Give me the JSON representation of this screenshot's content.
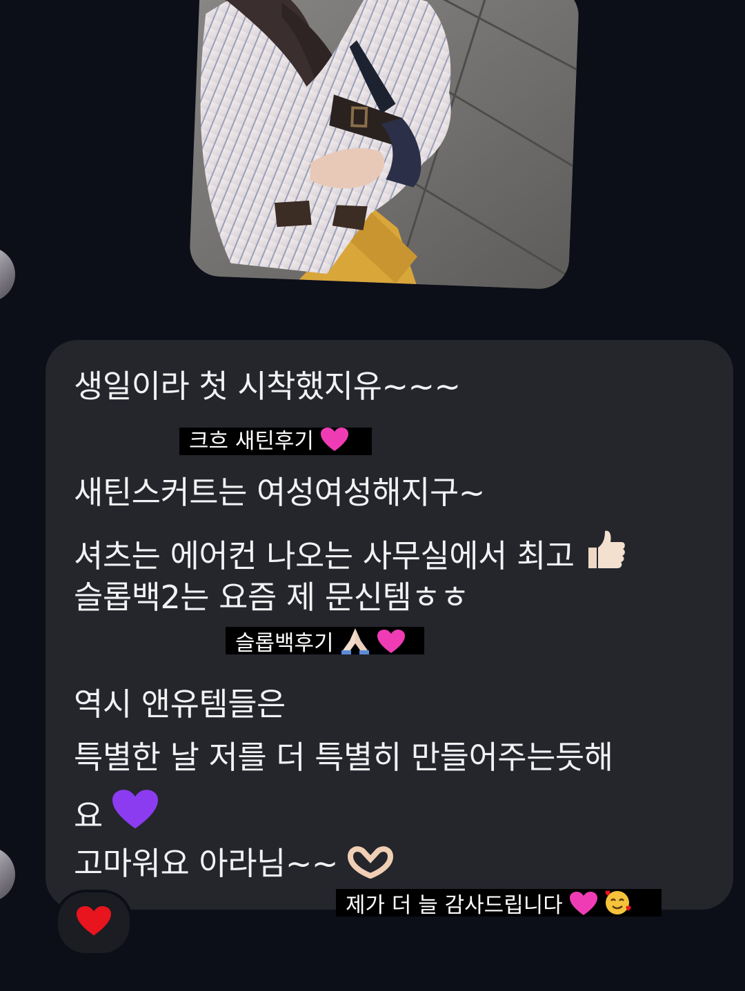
{
  "photo": {
    "icon": "photo-message"
  },
  "message": {
    "line1": "생일이라 첫 시착했지유~~~",
    "line2": "새틴스커트는 여성여성해지구~",
    "line3": "셔츠는 에어컨 나오는 사무실에서 최고",
    "line4": "슬롭백2는 요즘 제 문신템ㅎㅎ",
    "line5": "역시 앤유템들은",
    "line6": "특별한 날 저를 더 특별히 만들어주는듯해",
    "line7": "요",
    "line8": "고마워요 아라님~~"
  },
  "captions": {
    "caption1": "크흐 새틴후기",
    "caption2": "슬롭백후기",
    "caption3": "제가 더 늘 감사드립니다"
  },
  "reaction": {
    "icon": "red-heart-icon"
  },
  "colors": {
    "background": "#0c0e18",
    "bubble": "#24262c",
    "caption_bg": "#000000",
    "pink_heart": "#f03cb4",
    "purple_heart": "#8c3cf0",
    "red_heart": "#e8141e"
  }
}
